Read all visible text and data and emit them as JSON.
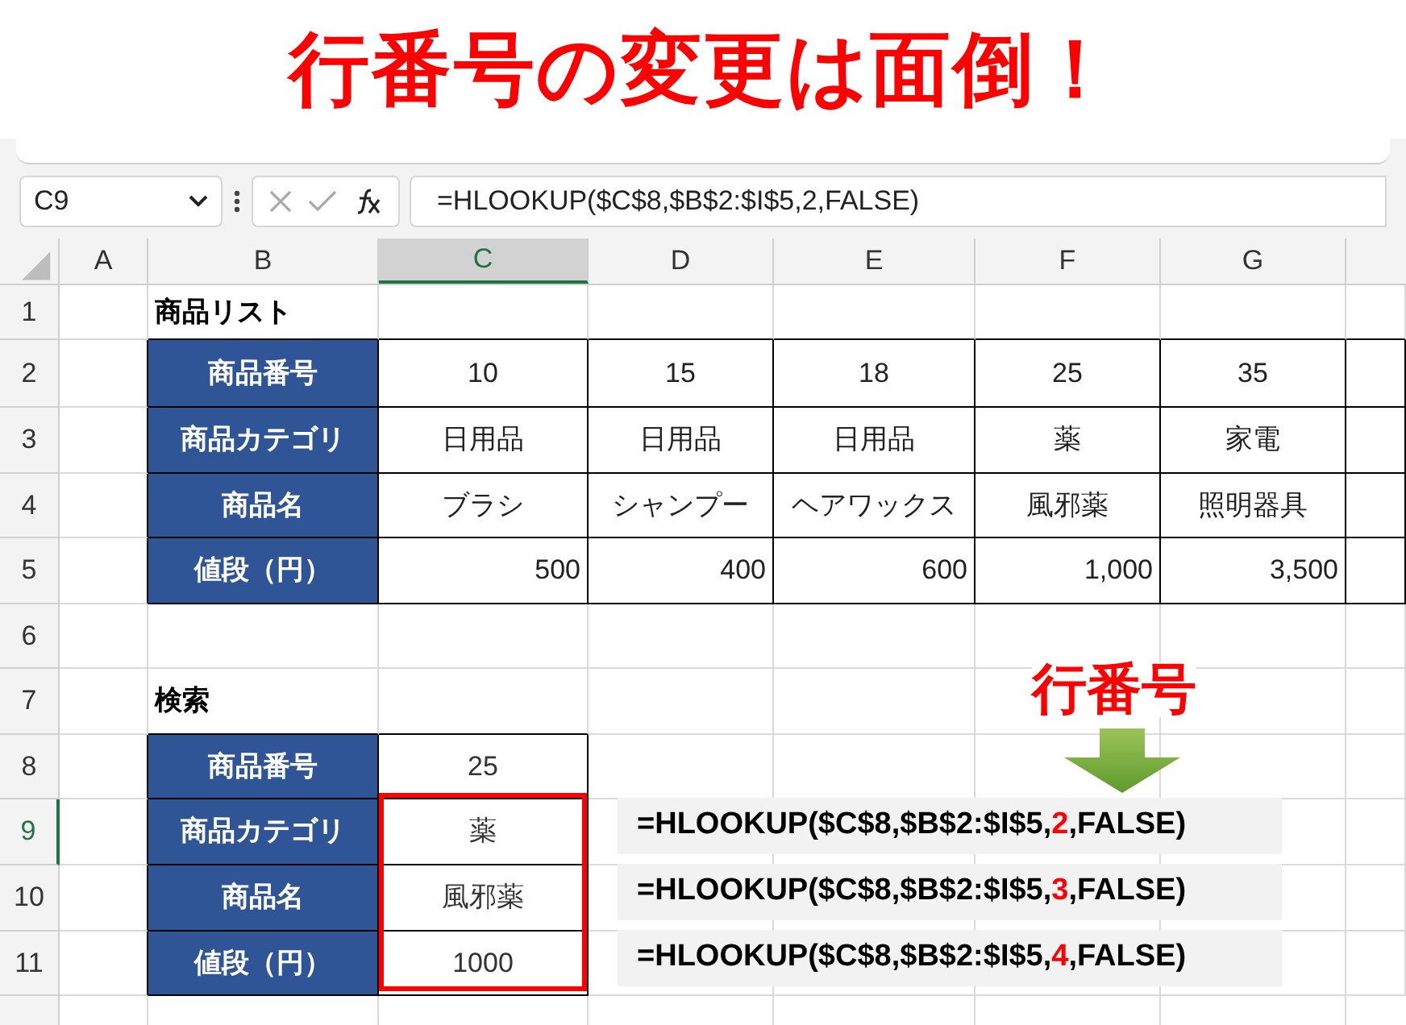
{
  "title": "行番号の変更は面倒！",
  "formula_bar": {
    "name_box": "C9",
    "formula": "=HLOOKUP($C$8,$B$2:$I$5,2,FALSE)"
  },
  "columns": [
    {
      "label": "A",
      "selected": false
    },
    {
      "label": "B",
      "selected": false
    },
    {
      "label": "C",
      "selected": true
    },
    {
      "label": "D",
      "selected": false
    },
    {
      "label": "E",
      "selected": false
    },
    {
      "label": "F",
      "selected": false
    },
    {
      "label": "G",
      "selected": false
    }
  ],
  "rows": [
    {
      "label": "1",
      "selected": false
    },
    {
      "label": "2",
      "selected": false
    },
    {
      "label": "3",
      "selected": false
    },
    {
      "label": "4",
      "selected": false
    },
    {
      "label": "5",
      "selected": false
    },
    {
      "label": "6",
      "selected": false
    },
    {
      "label": "7",
      "selected": false
    },
    {
      "label": "8",
      "selected": false
    },
    {
      "label": "9",
      "selected": true
    },
    {
      "label": "10",
      "selected": false
    },
    {
      "label": "11",
      "selected": false
    }
  ],
  "product_list": {
    "title": "商品リスト",
    "rows": [
      {
        "header": "商品番号",
        "kind": "text",
        "cells": [
          "10",
          "15",
          "18",
          "25",
          "35"
        ]
      },
      {
        "header": "商品カテゴリ",
        "kind": "text",
        "cells": [
          "日用品",
          "日用品",
          "日用品",
          "薬",
          "家電"
        ]
      },
      {
        "header": "商品名",
        "kind": "text",
        "cells": [
          "ブラシ",
          "シャンプー",
          "ヘアワックス",
          "風邪薬",
          "照明器具"
        ]
      },
      {
        "header": "値段（円）",
        "kind": "number",
        "cells": [
          "500",
          "400",
          "600",
          "1,000",
          "3,500"
        ]
      }
    ]
  },
  "search": {
    "title": "検索",
    "rows": [
      {
        "header": "商品番号",
        "value": "25"
      },
      {
        "header": "商品カテゴリ",
        "value": "薬"
      },
      {
        "header": "商品名",
        "value": "風邪薬"
      },
      {
        "header": "値段（円）",
        "value": "1000"
      }
    ]
  },
  "annotation": {
    "label": "行番号"
  },
  "formulas": [
    {
      "before": "=HLOOKUP($C$8,$B$2:$I$5,",
      "arg": "2",
      "after": ",FALSE)"
    },
    {
      "before": "=HLOOKUP($C$8,$B$2:$I$5,",
      "arg": "3",
      "after": ",FALSE)"
    },
    {
      "before": "=HLOOKUP($C$8,$B$2:$I$5,",
      "arg": "4",
      "after": ",FALSE)"
    }
  ]
}
